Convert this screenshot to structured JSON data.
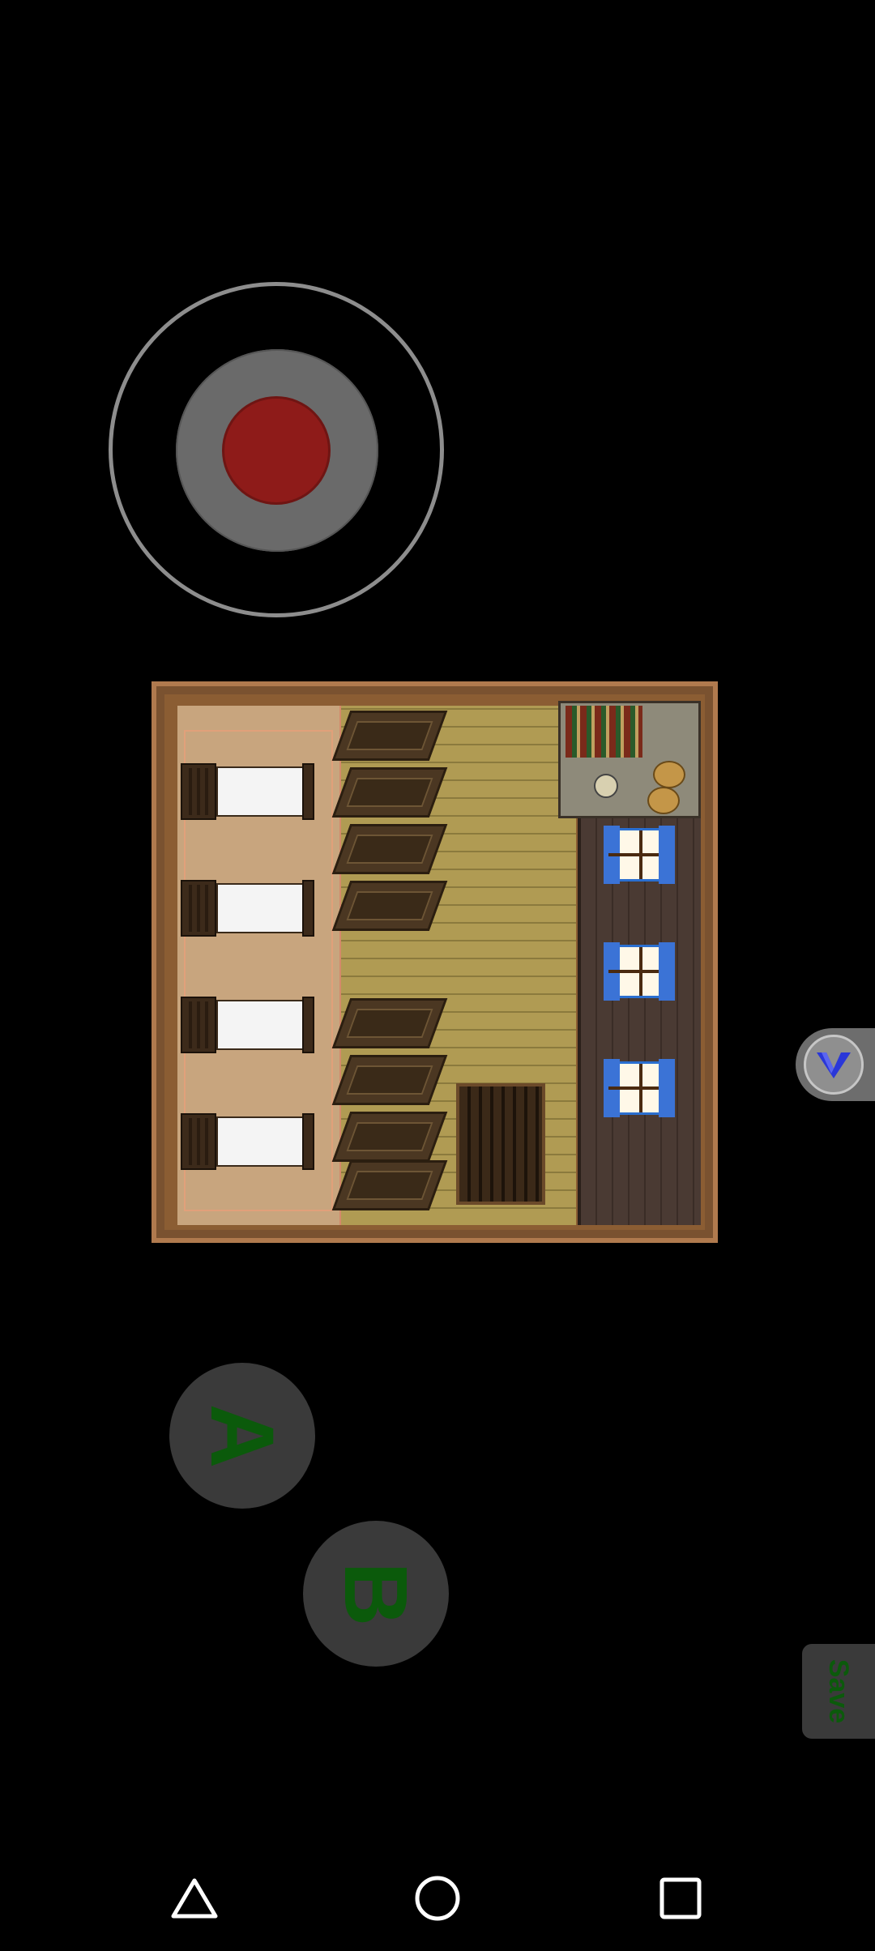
{
  "controls": {
    "joystick": "joystick",
    "a_button_label": "A",
    "b_button_label": "B",
    "save_label": "Save",
    "overlay_icon": "v-logo-icon"
  },
  "map": {
    "beds": 4,
    "windows": 3
  },
  "system_nav": {
    "back_icon": "triangle-back-icon",
    "home_icon": "circle-home-icon",
    "recents_icon": "square-recents-icon"
  },
  "colors": {
    "background": "#000000",
    "joystick_knob": "#8e1b19",
    "button_text": "#0b5a0b"
  }
}
